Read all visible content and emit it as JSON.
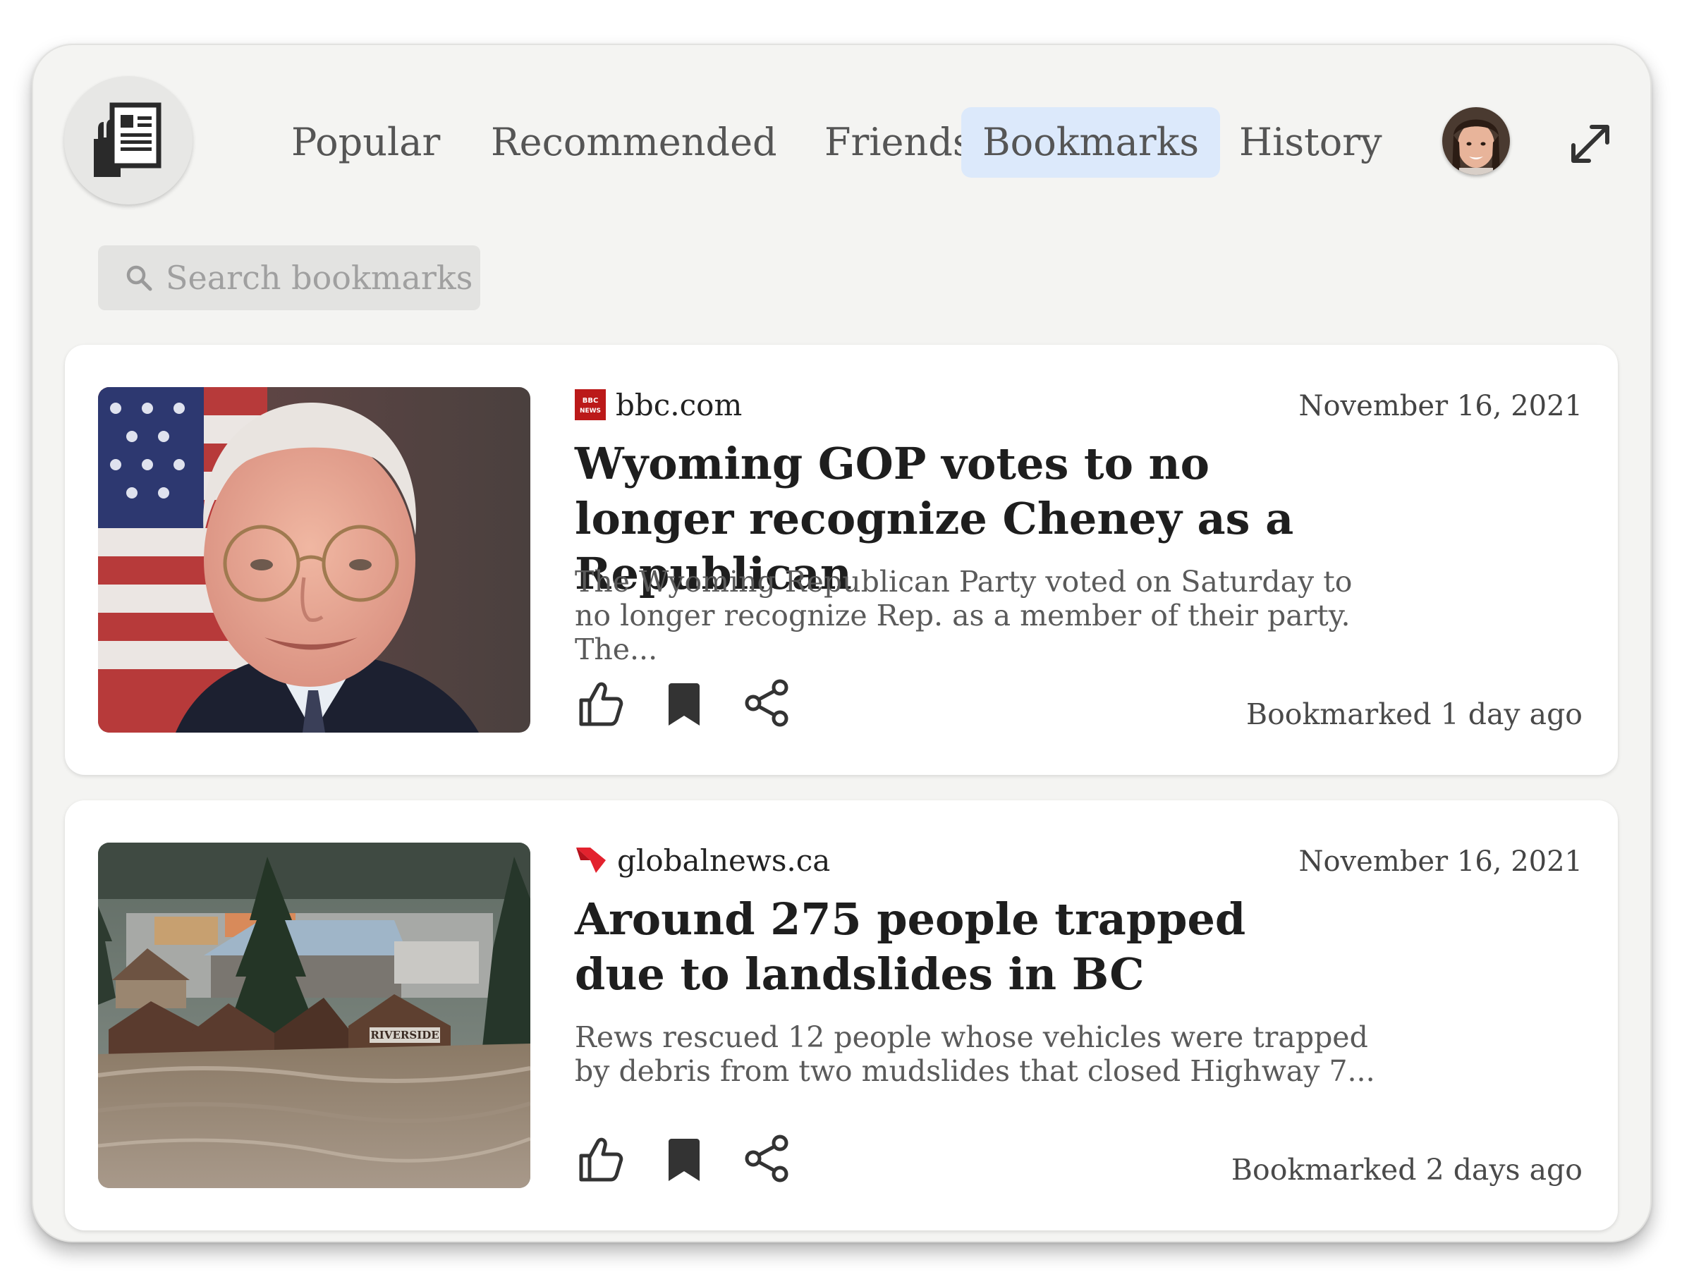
{
  "nav": {
    "tabs": [
      {
        "label": "Popular"
      },
      {
        "label": "Recommended"
      },
      {
        "label": "Friends"
      },
      {
        "label": "Bookmarks",
        "active": true
      },
      {
        "label": "History"
      }
    ]
  },
  "search": {
    "placeholder": "Search bookmarks"
  },
  "articles": [
    {
      "source": "bbc.com",
      "source_logo_text": "BBC NEWS",
      "date": "November 16, 2021",
      "title": "Wyoming GOP votes to no longer recognize Cheney as a Republican",
      "excerpt": "The Wyoming Republican Party voted on Saturday to no longer recognize Rep. as a member of their party. The...",
      "bookmarked": "Bookmarked 1 day ago"
    },
    {
      "source": "globalnews.ca",
      "date": "November 16, 2021",
      "title": "Around 275 people trapped due to landslides in BC",
      "excerpt": "Rews rescued 12 people whose vehicles were trapped by debris from two mudslides that closed Highway 7...",
      "bookmarked": "Bookmarked 2 days ago",
      "image_sign": "RIVERSIDE"
    }
  ],
  "colors": {
    "active_tab": "#dce9fb",
    "bbc_red": "#bb1919",
    "global_red": "#e3222e",
    "icon": "#333333"
  },
  "icons": [
    "app-logo-icon",
    "expand-icon",
    "search-icon",
    "thumbs-up-icon",
    "bookmark-icon",
    "share-icon"
  ]
}
